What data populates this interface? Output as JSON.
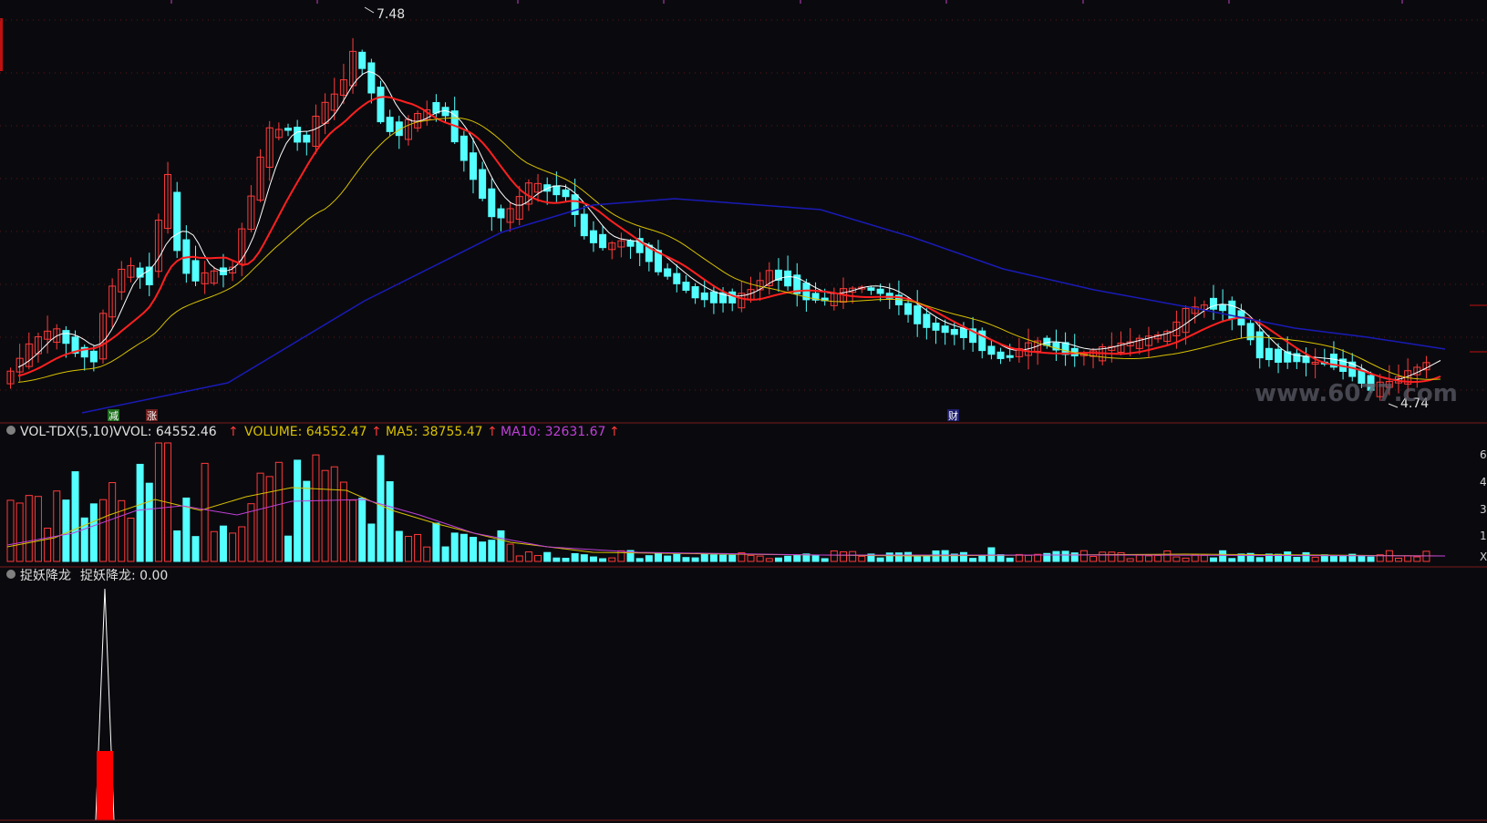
{
  "colors": {
    "bg": "#0a0a0e",
    "up": "#ff3a3a",
    "down": "#54ffff",
    "ma_white": "#ffffff",
    "ma_red": "#ff2020",
    "ma_yellow": "#d8c000",
    "ma_blue": "#1a1ab8",
    "grid": "#5a1414",
    "divider": "#7a1a1a",
    "vol_ma5": "#d8c000",
    "vol_ma10": "#c040d8",
    "text": "#d0d0d0",
    "watermark": "#5a5a66"
  },
  "price_panel": {
    "high_marker": "7.48",
    "low_marker": "4.74",
    "event_tags": [
      "减",
      "涨",
      "财"
    ],
    "watermark": "www.6077.com"
  },
  "volume_panel": {
    "name": "VOL-TDX(5,10)",
    "vvol": "VVOL: 64552.46",
    "volume": "VOLUME: 64552.47",
    "ma5": "MA5: 38755.47",
    "ma10": "MA10: 32631.67",
    "arrow": "↑",
    "axis_labels": [
      "6",
      "4",
      "3",
      "1",
      "X"
    ]
  },
  "indicator_panel": {
    "name": "捉妖降龙",
    "value": "捉妖降龙: 0.00"
  },
  "chart_data": {
    "type": "candlestick",
    "price_range": [
      4.74,
      7.48
    ],
    "moving_averages": [
      "white",
      "red",
      "yellow",
      "blue"
    ],
    "volume": {
      "last": 64552.47,
      "ma5": 38755.47,
      "ma10": 32631.67
    },
    "indicator": {
      "name": "捉妖降龙",
      "last": 0.0
    }
  }
}
